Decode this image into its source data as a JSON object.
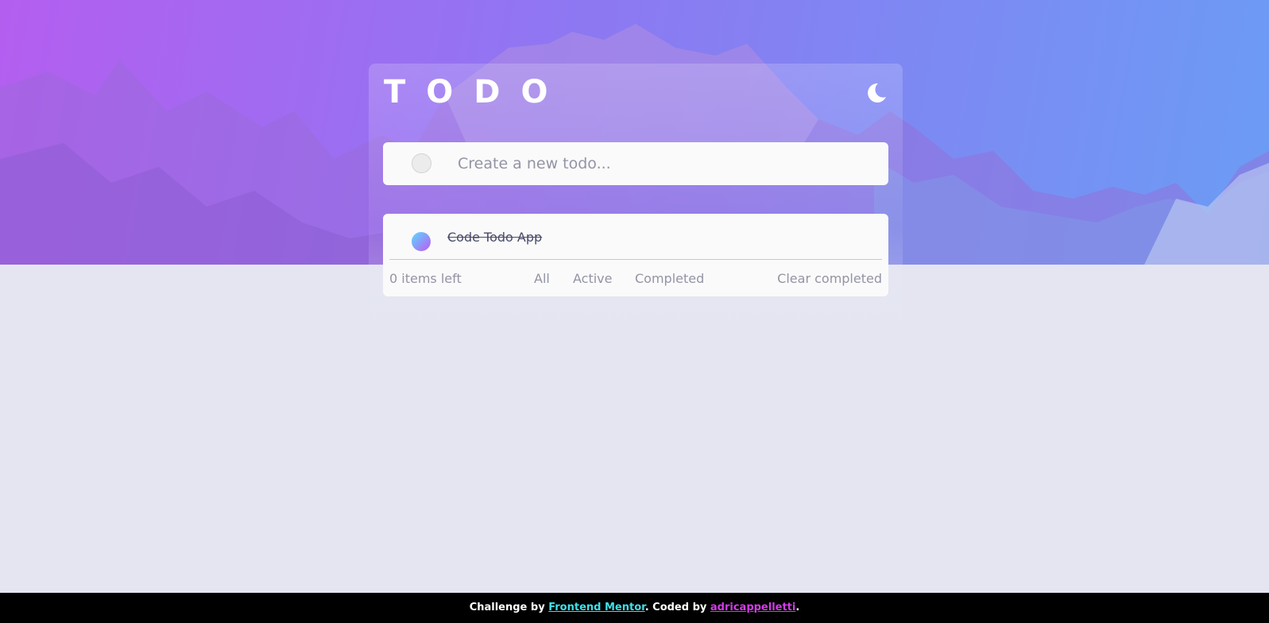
{
  "header": {
    "title": "TODO",
    "theme_toggle_icon": "moon-icon"
  },
  "new_todo": {
    "placeholder": "Create a new todo...",
    "value": ""
  },
  "todos": [
    {
      "text": "Code Todo App",
      "completed": true
    }
  ],
  "footer": {
    "items_left": "0 items left",
    "filters": [
      "All",
      "Active",
      "Completed"
    ],
    "clear_completed": "Clear completed"
  },
  "attribution": {
    "prefix": "Challenge by ",
    "frontend_mentor": "Frontend Mentor",
    "middle": ". Coded by ",
    "author": "adricappelletti",
    "suffix": "."
  },
  "colors": {
    "page_background": "#e4e5f1",
    "check_gradient_start": "#57ddff",
    "check_gradient_end": "#c058f3",
    "frontend_mentor_link": "#3ee0e8",
    "author_link": "#d33ce8"
  }
}
